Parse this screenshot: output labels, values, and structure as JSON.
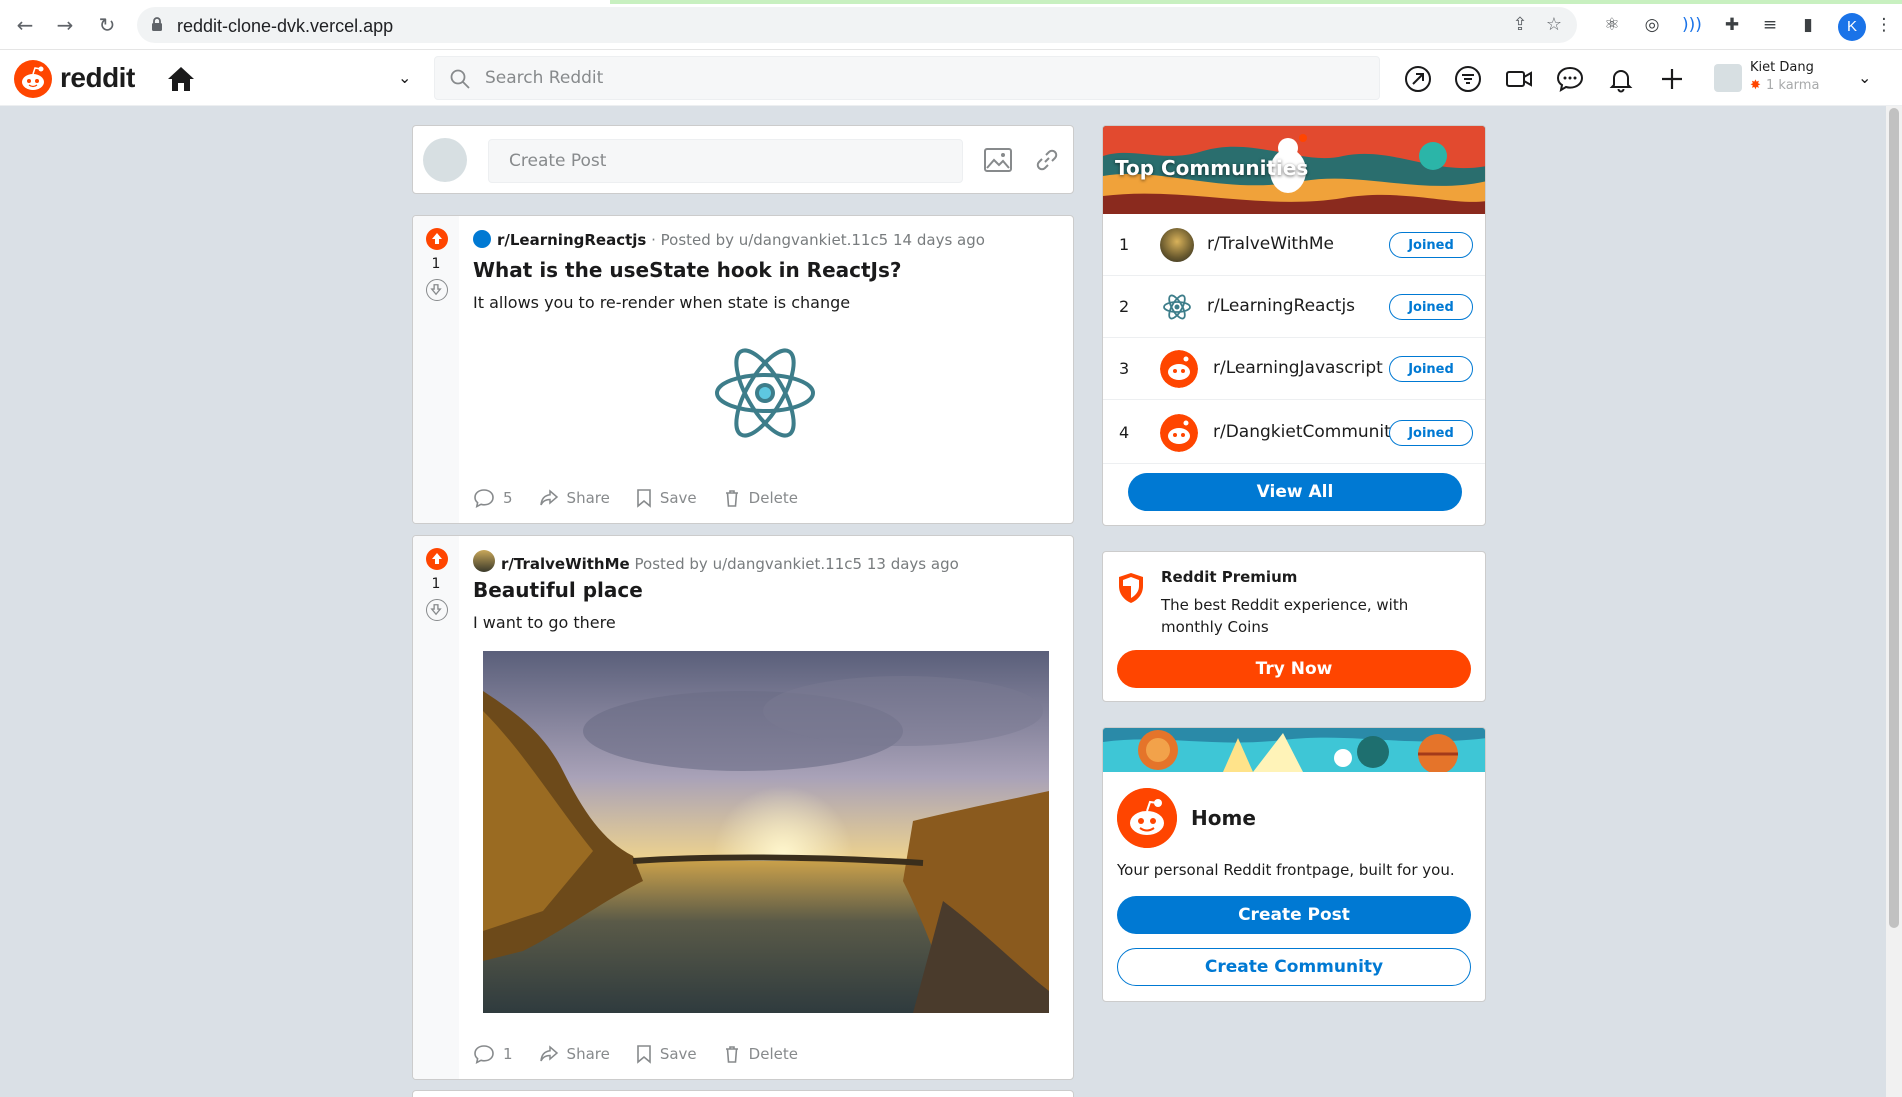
{
  "browser": {
    "url": "reddit-clone-dvk.vercel.app",
    "profile_initial": "K"
  },
  "header": {
    "logo_text": "reddit",
    "search_placeholder": "Search Reddit",
    "user": {
      "name": "Kiet Dang",
      "karma": "1 karma"
    }
  },
  "create_post": {
    "placeholder": "Create Post"
  },
  "posts": [
    {
      "subreddit": "r/LearningReactjs",
      "posted_by": "· Posted by u/dangvankiet.11c5",
      "time": "14 days ago",
      "votes": "1",
      "title": "What is the useState hook in ReactJs?",
      "body": "It allows you to re-render when state is change",
      "comments": "5",
      "share": "Share",
      "save": "Save",
      "delete": "Delete"
    },
    {
      "subreddit": "r/TralveWithMe",
      "posted_by": "Posted by u/dangvankiet.11c5",
      "time": "13 days ago",
      "votes": "1",
      "title": "Beautiful place",
      "body": "I want to go there",
      "comments": "1",
      "share": "Share",
      "save": "Save",
      "delete": "Delete"
    }
  ],
  "top_communities": {
    "title": "Top Communities",
    "items": [
      {
        "rank": "1",
        "name": "r/TralveWithMe",
        "status": "Joined"
      },
      {
        "rank": "2",
        "name": "r/LearningReactjs",
        "status": "Joined"
      },
      {
        "rank": "3",
        "name": "r/LearningJavascript",
        "status": "Joined"
      },
      {
        "rank": "4",
        "name": "r/DangkietCommunity",
        "status": "Joined"
      }
    ],
    "view_all": "View All"
  },
  "premium": {
    "title": "Reddit Premium",
    "description": "The best Reddit experience, with monthly Coins",
    "button": "Try Now"
  },
  "home_card": {
    "title": "Home",
    "description": "Your personal Reddit frontpage, built for you.",
    "create_post": "Create Post",
    "create_community": "Create Community"
  },
  "colors": {
    "brand": "#ff4500",
    "accent": "#0079d3",
    "background": "#dae0e6"
  }
}
